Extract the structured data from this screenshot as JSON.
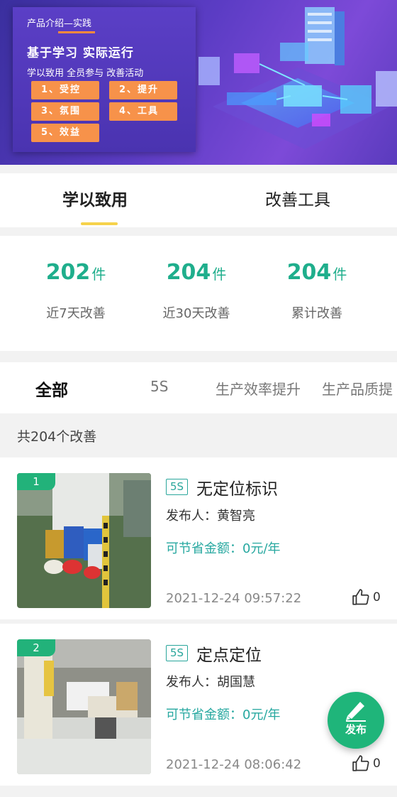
{
  "banner": {
    "kicker": "产品介绍—实践",
    "title": "基于学习 实际运行",
    "subtitle": "学以致用 全员参与 改善活动",
    "chips": [
      "1、受控",
      "2、提升",
      "3、氛围",
      "4、工具",
      "5、效益"
    ]
  },
  "tabs": [
    {
      "label": "学以致用",
      "active": true
    },
    {
      "label": "改善工具",
      "active": false
    }
  ],
  "stats": [
    {
      "value": "202",
      "unit": "件",
      "label": "近7天改善"
    },
    {
      "value": "204",
      "unit": "件",
      "label": "近30天改善"
    },
    {
      "value": "204",
      "unit": "件",
      "label": "累计改善"
    }
  ],
  "categories": [
    "全部",
    "5S",
    "生产效率提升",
    "生产品质提"
  ],
  "count_text": "共204个改善",
  "cards": [
    {
      "rank": "1",
      "tag": "5S",
      "title": "无定位标识",
      "publisher": "发布人：黄智亮",
      "saving": "可节省金额：0元/年",
      "time": "2021-12-24 09:57:22",
      "likes": "0"
    },
    {
      "rank": "2",
      "tag": "5S",
      "title": "定点定位",
      "publisher": "发布人：胡国慧",
      "saving": "可节省金额：0元/年",
      "time": "2021-12-24 08:06:42",
      "likes": "0"
    }
  ],
  "fab": {
    "label": "发布",
    "icon": "pen-icon"
  },
  "colors": {
    "accent": "#1fae8c",
    "tab_indicator": "#f6d24b",
    "fab": "#1fb57a",
    "rank_badge": "#22b27a"
  }
}
